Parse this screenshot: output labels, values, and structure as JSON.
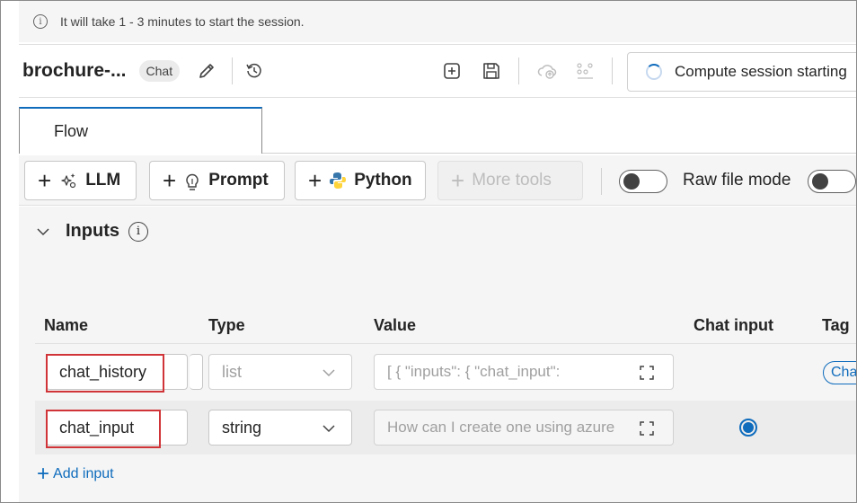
{
  "infobar": {
    "message": "It will take 1 - 3 minutes to start the session."
  },
  "header": {
    "flow_name": "brochure-...",
    "type_chip": "Chat",
    "session_status": "Compute session starting"
  },
  "tabs": [
    {
      "label": "Flow"
    }
  ],
  "toolbar": {
    "llm_label": "LLM",
    "prompt_label": "Prompt",
    "python_label": "Python",
    "more_tools_label": "More tools",
    "raw_file_mode_label": "Raw file mode"
  },
  "inputs": {
    "section_title": "Inputs",
    "columns": [
      "Name",
      "Type",
      "Value",
      "Chat input",
      "Tag"
    ],
    "rows": [
      {
        "name": "chat_history",
        "type": "list",
        "value": "[ {     \"inputs\": {       \"chat_input\": ",
        "chat_input_selected": false,
        "tag": "Chat"
      },
      {
        "name": "chat_input",
        "type": "string",
        "value": "How can I create one using azure",
        "chat_input_selected": true,
        "tag": ""
      }
    ],
    "add_input_label": "Add input"
  },
  "colors": {
    "accent": "#0f6cbd",
    "highlight": "#d13438"
  }
}
